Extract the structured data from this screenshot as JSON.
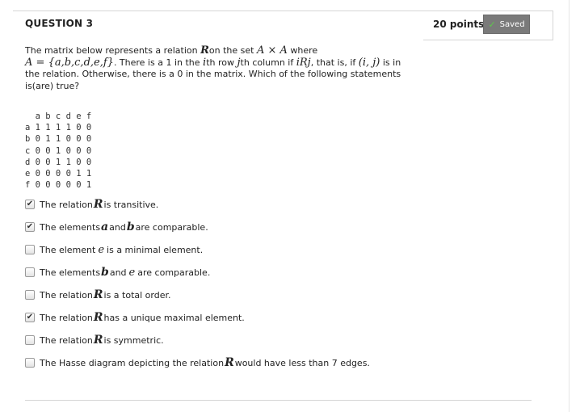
{
  "question": {
    "title": "QUESTION 3",
    "points": "20 points",
    "saved_label": "Saved",
    "text_parts": {
      "p1": "The matrix below represents a relation ",
      "R1": "R",
      "p2": "on the set ",
      "AxA": "A × A",
      "p3": " where",
      "Aset": "A = {a,b,c,d,e,f}",
      "p4": ". There is a 1 in the ",
      "i": "i",
      "p5": "th row ",
      "j": "j",
      "p6": "th column if ",
      "iRj": "iRj",
      "p7": ", that is, if ",
      "pair": "(i, j)",
      "p8": " is in the relation. Otherwise, there is a 0 in the matrix. Which of the following statements is(are) true?"
    },
    "matrix": {
      "header": "  a b c d e f",
      "rows": [
        "a 1 1 1 1 0 0",
        "b 0 1 1 0 0 0",
        "c 0 0 1 0 0 0",
        "d 0 0 1 1 0 0",
        "e 0 0 0 0 1 1",
        "f 0 0 0 0 0 1"
      ]
    },
    "options": [
      {
        "checked": true,
        "a": "The relation ",
        "sym": "R",
        "b": "is transitive."
      },
      {
        "checked": true,
        "a": "The elements ",
        "sym": "a",
        "b": "and ",
        "sym2": "b",
        "c": "are comparable."
      },
      {
        "checked": false,
        "a": "The element ",
        "sym": "e",
        "b": "is a minimal element."
      },
      {
        "checked": false,
        "a": "The elements ",
        "sym": "b",
        "b": "and ",
        "sym2": "e",
        "c": "are comparable."
      },
      {
        "checked": false,
        "a": "The relation ",
        "sym": "R",
        "b": "is a total order."
      },
      {
        "checked": true,
        "a": "The relation ",
        "sym": "R",
        "b": "has a unique maximal element."
      },
      {
        "checked": false,
        "a": "The relation ",
        "sym": "R",
        "b": "is symmetric."
      },
      {
        "checked": false,
        "a": "The Hasse diagram depicting  the relation ",
        "sym": "R",
        "b": "would have less than 7 edges."
      }
    ]
  },
  "colors": {
    "saved_bg": "#7a7a7a",
    "check_green": "#5ec94b"
  }
}
